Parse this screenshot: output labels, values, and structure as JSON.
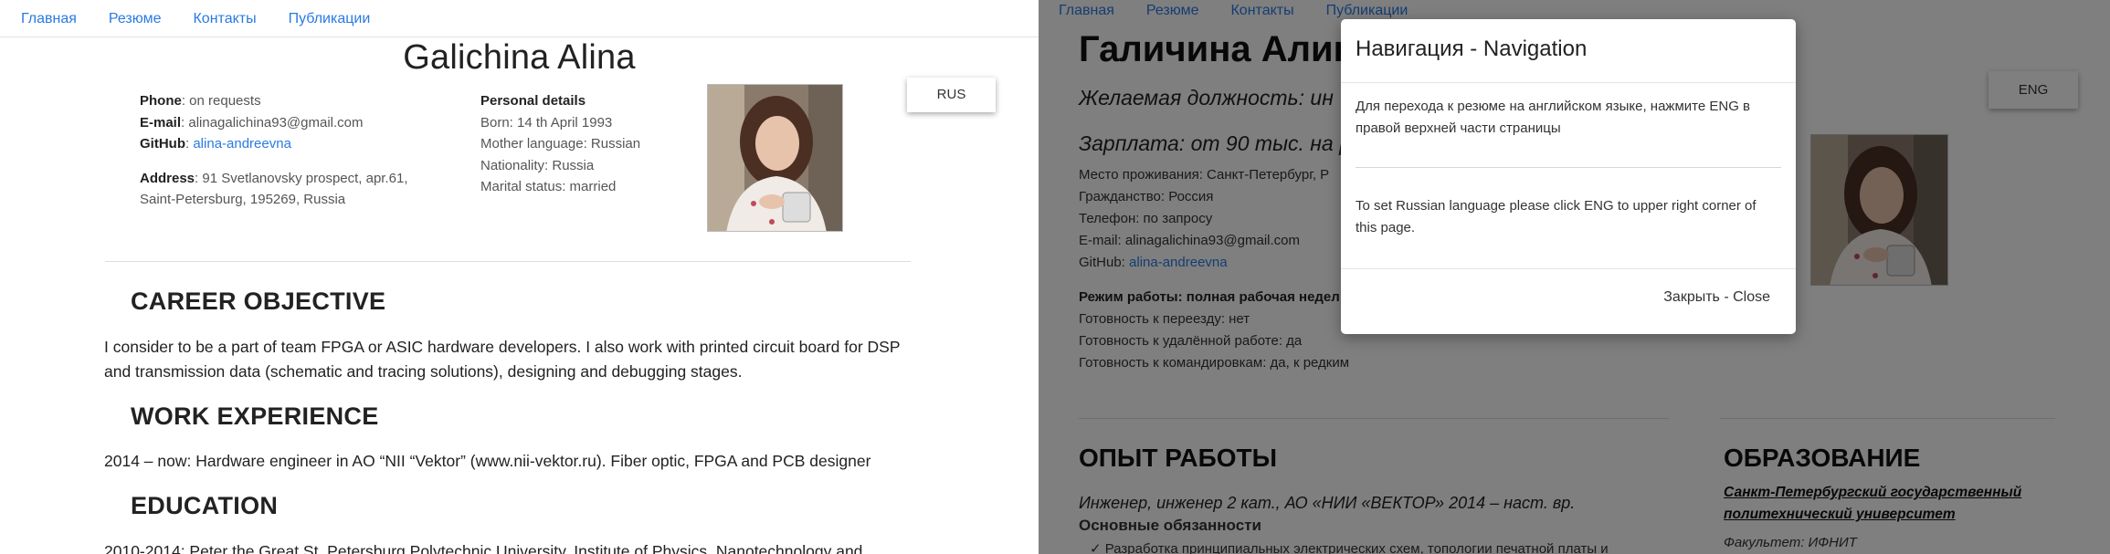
{
  "left": {
    "nav": [
      "Главная",
      "Резюме",
      "Контакты",
      "Публикации"
    ],
    "name": "Galichina Alina",
    "contact": {
      "phone_label": "Phone",
      "phone_value": ": on requests",
      "email_label": "E-mail",
      "email_value": ": alinagalichina93@gmail.com",
      "github_label": "GitHub",
      "github_sep": ": ",
      "github_value": "alina-andreevna",
      "address_label": "Address",
      "address_value_1": ": 91 Svetlanovsky prospect, apr.61,",
      "address_value_2": "Saint-Petersburg, 195269, Russia"
    },
    "personal": {
      "title": "Personal details",
      "born": "Born: 14 th April 1993",
      "mother_language": "Mother language: Russian",
      "nationality": "Nationality: Russia",
      "marital": "Marital status: married"
    },
    "lang_button": "RUS",
    "career_heading": "CAREER OBJECTIVE",
    "career_text_1": "I consider to be a part of team FPGA or ASIC hardware developers. I also work with printed circuit board for DSP",
    "career_text_2": "and transmission data (schematic and tracing solutions), designing and debugging stages.",
    "work_heading": "WORK EXPERIENCE",
    "work_text": "2014 – now: Hardware engineer in AO “NII “Vektor” (www.nii-vektor.ru). Fiber optic, FPGA and PCB designer",
    "edu_heading": "EDUCATION",
    "edu_text": "2010-2014: Peter the Great St. Petersburg Polytechnic University, Institute of Physics, Nanotechnology and"
  },
  "right": {
    "nav": [
      "Главная",
      "Резюме",
      "Контакты",
      "Публикации"
    ],
    "name": "Галичина Алин",
    "job": "Желаемая должность: ин",
    "salary": "Зарплата: от 90 тыс. на р",
    "info": [
      "Место проживания: Санкт-Петербург, Р",
      "Гражданство: Россия",
      "Телефон: по запросу",
      "E-mail: alinagalichina93@gmail.com"
    ],
    "github_label": "GitHub: ",
    "github_value": "alina-andreevna",
    "work_mode": "Режим работы: полная рабочая недел",
    "relocation": "Готовность к переезду: нет",
    "remote": "Готовность к удалённой работе: да",
    "travel": "Готовность к командировкам: да, к редким",
    "exp_heading": "ОПЫТ РАБОТЫ",
    "edu_heading": "ОБРАЗОВАНИЕ",
    "position": "Инженер, инженер 2 кат., АО «НИИ «ВЕКТОР» 2014 – наст. вр.",
    "duties": "Основные обязанности",
    "duty_line": "✓  Разработка принципиальных электрических схем, топологии печатной платы и",
    "university": "Санкт-Петербургский государственный политехнический университет",
    "faculty": "Факультет: ИФНИТ",
    "lang_button": "ENG"
  },
  "modal": {
    "title": "Навигация - Navigation",
    "text_ru": "Для перехода к резюме на английском языке, нажмите ENG в правой верхней части страницы",
    "text_en": "To set Russian language please click ENG to upper right corner of this page.",
    "close": "Закрыть - Close"
  },
  "colors": {
    "link": "#2a7ae2",
    "overlay": "rgba(0,0,0,0.5)"
  },
  "icons": {
    "photo": "portrait-photo",
    "check": "checkmark-icon"
  }
}
